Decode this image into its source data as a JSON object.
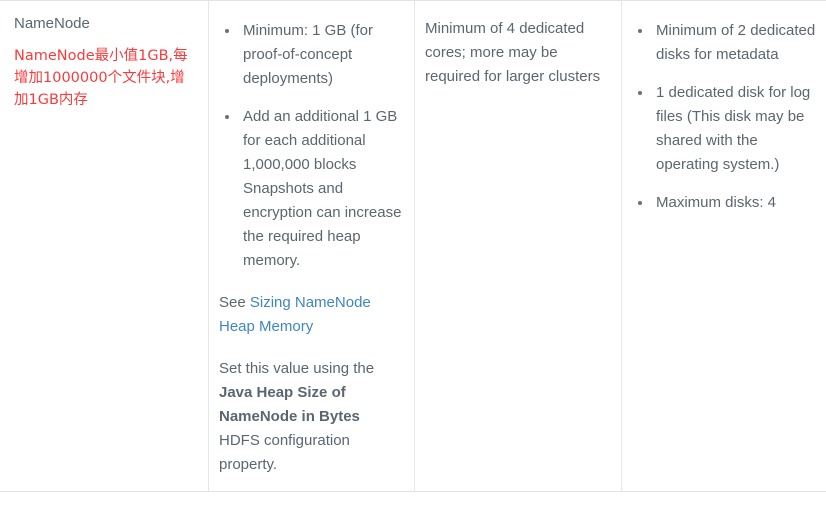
{
  "table": {
    "columns": [
      {
        "name": "role-column",
        "title": "NameNode",
        "annotation": "NameNode最小值1GB,每增加1000000个文件块,增加1GB内存"
      },
      {
        "name": "memory-column",
        "bullets": [
          "Minimum: 1 GB (for proof-of-concept deployments)",
          "Add an additional 1 GB for each additional 1,000,000 blocks Snapshots and encryption can increase the required heap memory."
        ],
        "link_prefix": "See ",
        "link_text": "Sizing NameNode Heap Memory",
        "property_prefix": "Set this value using the ",
        "property_bold": "Java Heap Size of NameNode in Bytes",
        "property_suffix": " HDFS configuration property."
      },
      {
        "name": "cpu-column",
        "text": "Minimum of 4 dedicated cores; more may be required for larger clusters"
      },
      {
        "name": "disk-column",
        "bullets": [
          "Minimum of 2 dedicated disks for metadata",
          "1 dedicated disk for log files (This disk may be shared with the operating system.)",
          "Maximum disks: 4"
        ]
      }
    ]
  },
  "colors": {
    "text": "#5c6670",
    "annotation": "#fb3b3b",
    "link": "#3d87c2",
    "border": "#e2e2e2"
  }
}
